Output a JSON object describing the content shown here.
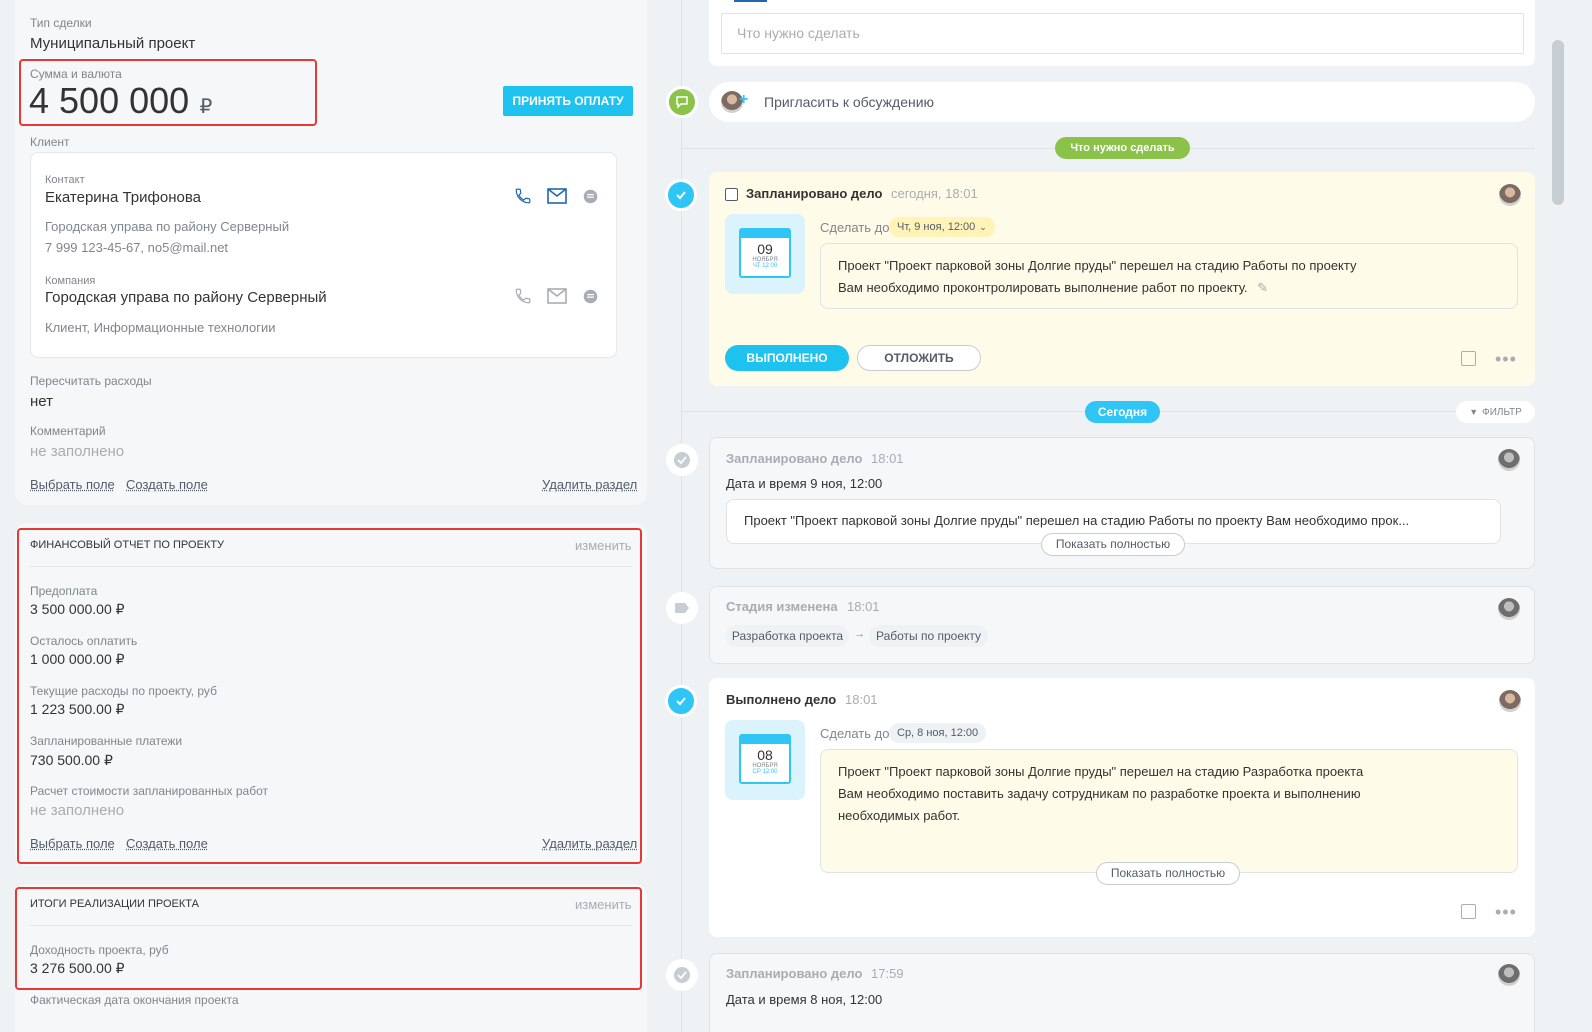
{
  "left": {
    "deal_type": {
      "label": "Тип сделки",
      "value": "Муниципальный проект"
    },
    "amount": {
      "label": "Сумма и валюта",
      "value": "4 500 000",
      "currency": "₽",
      "button": "ПРИНЯТЬ ОПЛАТУ"
    },
    "client": {
      "label": "Клиент",
      "contact": {
        "label": "Контакт",
        "name": "Екатерина Трифонова",
        "company": "Городская управа по району Серверный",
        "details": "7 999 123-45-67, no5@mail.net"
      },
      "company": {
        "label": "Компания",
        "name": "Городская управа по району Серверный",
        "details": "Клиент, Информационные технологии"
      }
    },
    "recalc": {
      "label": "Пересчитать расходы",
      "value": "нет"
    },
    "comment": {
      "label": "Комментарий",
      "value": "не заполнено"
    },
    "actions": {
      "select_field": "Выбрать поле",
      "create_field": "Создать поле",
      "delete_section": "Удалить раздел"
    },
    "finance": {
      "title": "ФИНАНСОВЫЙ ОТЧЕТ ПО ПРОЕКТУ",
      "edit": "изменить",
      "fields": [
        {
          "label": "Предоплата",
          "value": "3 500 000.00 ₽"
        },
        {
          "label": "Осталось оплатить",
          "value": "1 000 000.00 ₽"
        },
        {
          "label": "Текущие расходы по проекту, руб",
          "value": "1 223 500.00 ₽"
        },
        {
          "label": "Запланированные платежи",
          "value": "730 500.00 ₽"
        }
      ],
      "calc": {
        "label": "Расчет стоимости запланированных работ",
        "value": "не заполнено"
      }
    },
    "results": {
      "title": "ИТОГИ РЕАЛИЗАЦИИ ПРОЕКТА",
      "edit": "изменить",
      "income": {
        "label": "Доходность проекта, руб",
        "value": "3 276 500.00 ₽"
      },
      "end_date": {
        "label": "Фактическая дата окончания проекта"
      }
    }
  },
  "right": {
    "todo_placeholder": "Что нужно сделать",
    "invite": "Пригласить к обсуждению",
    "badge_todo": "Что нужно сделать",
    "badge_today": "Сегодня",
    "filter": "ФИЛЬТР",
    "planned": {
      "title": "Запланировано дело",
      "time": "сегодня, 18:01",
      "deadline_label": "Сделать до",
      "deadline": "Чт, 9 ноя, 12:00",
      "cal_day": "09",
      "cal_month": "НОЯБРЯ",
      "cal_sub": "ЧТ 12:00",
      "line1": "Проект \"Проект парковой зоны Долгие пруды\" перешел на стадию Работы по проекту",
      "line2": "Вам необходимо проконтролировать выполнение работ по проекту.",
      "done": "ВЫПОЛНЕНО",
      "postpone": "ОТЛОЖИТЬ"
    },
    "hist1": {
      "title": "Запланировано дело",
      "time": "18:01",
      "datetime": "Дата и время 9 ноя, 12:00",
      "text": "Проект \"Проект парковой зоны Долгие пруды\" перешел на стадию Работы по проекту Вам необходимо прок...",
      "show": "Показать полностью"
    },
    "stage": {
      "title": "Стадия изменена",
      "time": "18:01",
      "from": "Разработка проекта",
      "to": "Работы по проекту"
    },
    "done_item": {
      "title": "Выполнено дело",
      "time": "18:01",
      "deadline_label": "Сделать до",
      "deadline": "Ср, 8 ноя, 12:00",
      "cal_day": "08",
      "cal_month": "НОЯБРЯ",
      "cal_sub": "СР 12:00",
      "line1": "Проект \"Проект парковой зоны Долгие пруды\" перешел на стадию Разработка проекта",
      "line2": "Вам необходимо поставить задачу сотрудникам по разработке проекта и выполнению",
      "line3": "необходимых работ.",
      "show": "Показать полностью"
    },
    "hist2": {
      "title": "Запланировано дело",
      "time": "17:59",
      "datetime": "Дата и время 8 ноя, 12:00"
    }
  },
  "colors": {
    "accent": "#1ec2ee",
    "green": "#8bc34a",
    "highlight": "#e53935",
    "yellow_bg": "#fefce8"
  }
}
